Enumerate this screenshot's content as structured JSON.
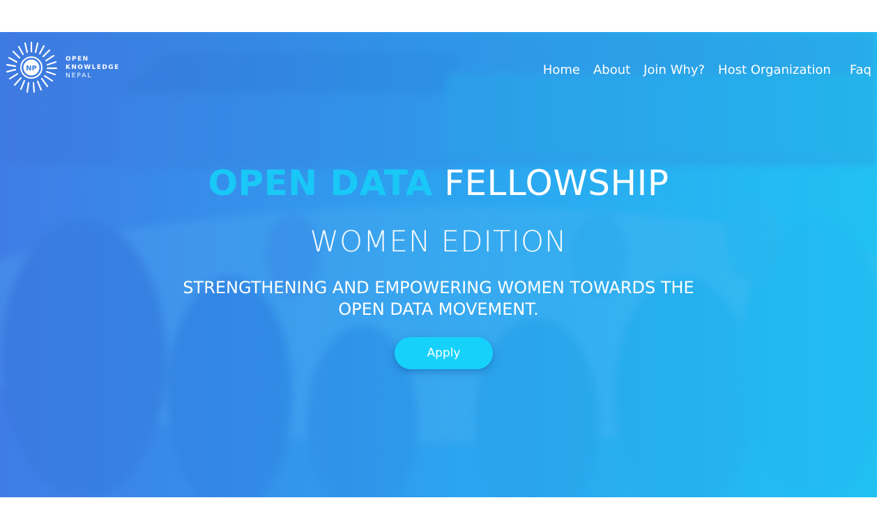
{
  "logo": {
    "badge": "NP",
    "line1": "OPEN",
    "line2": "KNOWLEDGE",
    "line3": "NEPAL"
  },
  "nav": {
    "items": [
      {
        "label": "Home"
      },
      {
        "label": "About"
      },
      {
        "label": "Join Why?"
      },
      {
        "label": "Host Organization"
      },
      {
        "label": "Faq"
      }
    ]
  },
  "hero": {
    "title_accent": "OPEN DATA",
    "title_main": "FELLOWSHIP",
    "subtitle": "WOMEN EDITION",
    "tagline_line1": "STRENGTHENING AND EMPOWERING WOMEN TOWARDS THE",
    "tagline_line2": "OPEN DATA MOVEMENT.",
    "cta_label": "Apply"
  },
  "colors": {
    "accent": "#19c8f7",
    "button": "#16d2fb",
    "hero_left": "#3f7fe6",
    "hero_right": "#22bff2"
  }
}
